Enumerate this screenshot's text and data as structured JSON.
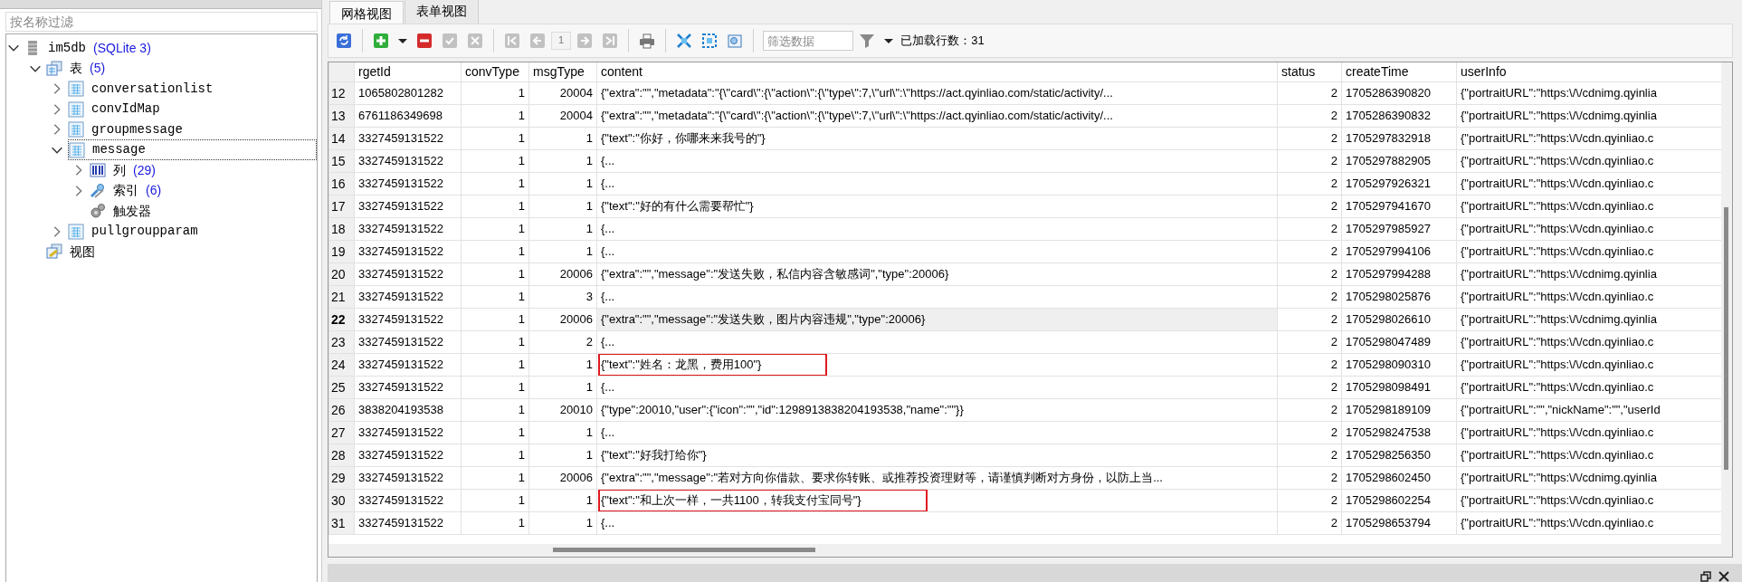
{
  "object_panel": {
    "filter": {
      "placeholder": "按名称过滤"
    },
    "tree": [
      {
        "label": "im5db",
        "count": "(SQLite 3)",
        "kind": "database",
        "expanded": true,
        "selected": false,
        "children": [
          {
            "label": "表",
            "count": "(5)",
            "kind": "tables",
            "expanded": true,
            "selected": false,
            "children": [
              {
                "label": "conversationlist",
                "kind": "table",
                "expanded": false,
                "selected": false
              },
              {
                "label": "convIdMap",
                "kind": "table",
                "expanded": false,
                "selected": false
              },
              {
                "label": "groupmessage",
                "kind": "table",
                "expanded": false,
                "selected": false
              },
              {
                "label": "message",
                "kind": "table",
                "expanded": true,
                "selected": true,
                "children": [
                  {
                    "label": "列",
                    "count": "(29)",
                    "kind": "columns",
                    "expanded": false,
                    "selected": false
                  },
                  {
                    "label": "索引",
                    "count": "(6)",
                    "kind": "indexes",
                    "expanded": false,
                    "selected": false
                  },
                  {
                    "label": "触发器",
                    "kind": "triggers",
                    "selected": false
                  }
                ]
              },
              {
                "label": "pullgroupparam",
                "kind": "table",
                "expanded": false,
                "selected": false
              }
            ]
          },
          {
            "label": "视图",
            "kind": "views",
            "selected": false
          }
        ]
      }
    ]
  },
  "tabs": [
    {
      "label": "网格视图",
      "selected": true
    },
    {
      "label": "表单视图",
      "selected": false
    }
  ],
  "toolbar": [
    {
      "kind": "refresh",
      "disabled": false
    },
    {
      "kind": "separator"
    },
    {
      "kind": "add",
      "disabled": false
    },
    {
      "kind": "caret",
      "disabled": false
    },
    {
      "kind": "delete",
      "disabled": false
    },
    {
      "kind": "confirm",
      "disabled": true
    },
    {
      "kind": "cancel",
      "disabled": true
    },
    {
      "kind": "separator"
    },
    {
      "kind": "first",
      "disabled": true
    },
    {
      "kind": "previous",
      "disabled": true
    },
    {
      "kind": "page",
      "value": "1"
    },
    {
      "kind": "next",
      "disabled": true
    },
    {
      "kind": "last",
      "disabled": true
    },
    {
      "kind": "separator"
    },
    {
      "kind": "print",
      "disabled": false
    },
    {
      "kind": "separator"
    },
    {
      "kind": "expand",
      "disabled": false
    },
    {
      "kind": "fit",
      "disabled": false
    },
    {
      "kind": "image",
      "disabled": false
    },
    {
      "kind": "separator"
    },
    {
      "kind": "filter",
      "placeholder": "筛选数据"
    },
    {
      "kind": "funnel",
      "disabled": false
    },
    {
      "kind": "caret",
      "disabled": false
    },
    {
      "kind": "label",
      "text": "已加载行数：31"
    }
  ],
  "table": {
    "columns": [
      "rgetId",
      "convType",
      "msgType",
      "content",
      "status",
      "createTime",
      "userInfo"
    ],
    "rows": [
      {
        "number": "12",
        "cells": [
          "1065802801282",
          "1",
          "20004",
          "{\"extra\":\"\",\"metadata\":\"{\\\"card\\\":{\\\"action\\\":{\\\"type\\\":7,\\\"url\\\":\\\"https://act.qyinliao.com/static/activity/...",
          "2",
          "1705286390820",
          "{\"portraitURL\":\"https:\\/\\/cdnimg.qyinlia"
        ],
        "selected": false,
        "highlighted": false
      },
      {
        "number": "13",
        "cells": [
          "6761186349698",
          "1",
          "20004",
          "{\"extra\":\"\",\"metadata\":\"{\\\"card\\\":{\\\"action\\\":{\\\"type\\\":7,\\\"url\\\":\\\"https://act.qyinliao.com/static/activity/...",
          "2",
          "1705286390832",
          "{\"portraitURL\":\"https:\\/\\/cdnimg.qyinlia"
        ],
        "selected": false,
        "highlighted": false
      },
      {
        "number": "14",
        "cells": [
          "3327459131522",
          "1",
          "1",
          "{\"text\":\"你好，你哪来来我号的\"}",
          "2",
          "1705297832918",
          "{\"portraitURL\":\"https:\\/\\/cdn.qyinliao.c"
        ],
        "selected": false,
        "highlighted": false
      },
      {
        "number": "15",
        "cells": [
          "3327459131522",
          "1",
          "1",
          "{...",
          "2",
          "1705297882905",
          "{\"portraitURL\":\"https:\\/\\/cdn.qyinliao.c"
        ],
        "selected": false,
        "highlighted": false
      },
      {
        "number": "16",
        "cells": [
          "3327459131522",
          "1",
          "1",
          "{...",
          "2",
          "1705297926321",
          "{\"portraitURL\":\"https:\\/\\/cdn.qyinliao.c"
        ],
        "selected": false,
        "highlighted": false
      },
      {
        "number": "17",
        "cells": [
          "3327459131522",
          "1",
          "1",
          "{\"text\":\"好的有什么需要帮忙\"}",
          "2",
          "1705297941670",
          "{\"portraitURL\":\"https:\\/\\/cdn.qyinliao.c"
        ],
        "selected": false,
        "highlighted": false
      },
      {
        "number": "18",
        "cells": [
          "3327459131522",
          "1",
          "1",
          "{...",
          "2",
          "1705297985927",
          "{\"portraitURL\":\"https:\\/\\/cdn.qyinliao.c"
        ],
        "selected": false,
        "highlighted": false
      },
      {
        "number": "19",
        "cells": [
          "3327459131522",
          "1",
          "1",
          "{...",
          "2",
          "1705297994106",
          "{\"portraitURL\":\"https:\\/\\/cdn.qyinliao.c"
        ],
        "selected": false,
        "highlighted": false
      },
      {
        "number": "20",
        "cells": [
          "3327459131522",
          "1",
          "20006",
          "{\"extra\":\"\",\"message\":\"发送失败，私信内容含敏感词\",\"type\":20006}",
          "2",
          "1705297994288",
          "{\"portraitURL\":\"https:\\/\\/cdnimg.qyinlia"
        ],
        "selected": false,
        "highlighted": false
      },
      {
        "number": "21",
        "cells": [
          "3327459131522",
          "1",
          "3",
          "{...",
          "2",
          "1705298025876",
          "{\"portraitURL\":\"https:\\/\\/cdn.qyinliao.c"
        ],
        "selected": false,
        "highlighted": false
      },
      {
        "number": "22",
        "cells": [
          "3327459131522",
          "1",
          "20006",
          "{\"extra\":\"\",\"message\":\"发送失败，图片内容违规\",\"type\":20006}",
          "2",
          "1705298026610",
          "{\"portraitURL\":\"https:\\/\\/cdnimg.qyinlia"
        ],
        "selected": true,
        "highlighted": false
      },
      {
        "number": "23",
        "cells": [
          "3327459131522",
          "1",
          "2",
          "{...",
          "2",
          "1705298047489",
          "{\"portraitURL\":\"https:\\/\\/cdn.qyinliao.c"
        ],
        "selected": false,
        "highlighted": false
      },
      {
        "number": "24",
        "cells": [
          "3327459131522",
          "1",
          "1",
          "{\"text\":\"姓名：龙黑，费用100\"}",
          "2",
          "1705298090310",
          "{\"portraitURL\":\"https:\\/\\/cdn.qyinliao.c"
        ],
        "selected": false,
        "highlighted": true
      },
      {
        "number": "25",
        "cells": [
          "3327459131522",
          "1",
          "1",
          "{...",
          "2",
          "1705298098491",
          "{\"portraitURL\":\"https:\\/\\/cdn.qyinliao.c"
        ],
        "selected": false,
        "highlighted": false
      },
      {
        "number": "26",
        "cells": [
          "3838204193538",
          "1",
          "20010",
          "{\"type\":20010,\"user\":{\"icon\":\"\",\"id\":1298913838204193538,\"name\":\"\"}}",
          "2",
          "1705298189109",
          "{\"portraitURL\":\"\",\"nickName\":\"\",\"userId"
        ],
        "selected": false,
        "highlighted": false
      },
      {
        "number": "27",
        "cells": [
          "3327459131522",
          "1",
          "1",
          "{...",
          "2",
          "1705298247538",
          "{\"portraitURL\":\"https:\\/\\/cdn.qyinliao.c"
        ],
        "selected": false,
        "highlighted": false
      },
      {
        "number": "28",
        "cells": [
          "3327459131522",
          "1",
          "1",
          "{\"text\":\"好我打给你\"}",
          "2",
          "1705298256350",
          "{\"portraitURL\":\"https:\\/\\/cdn.qyinliao.c"
        ],
        "selected": false,
        "highlighted": false
      },
      {
        "number": "29",
        "cells": [
          "3327459131522",
          "1",
          "20006",
          "{\"extra\":\"\",\"message\":\"若对方向你借款、要求你转账、或推荐投资理财等，请谨慎判断对方身份，以防上当...",
          "2",
          "1705298602450",
          "{\"portraitURL\":\"https:\\/\\/cdnimg.qyinlia"
        ],
        "selected": false,
        "highlighted": false
      },
      {
        "number": "30",
        "cells": [
          "3327459131522",
          "1",
          "1",
          "{\"text\":\"和上次一样，一共1100，转我支付宝同号\"}",
          "2",
          "1705298602254",
          "{\"portraitURL\":\"https:\\/\\/cdn.qyinliao.c"
        ],
        "selected": false,
        "highlighted": true
      },
      {
        "number": "31",
        "cells": [
          "3327459131522",
          "1",
          "1",
          "{...",
          "2",
          "1705298653794",
          "{\"portraitURL\":\"https:\\/\\/cdn.qyinliao.c"
        ],
        "selected": false,
        "highlighted": false
      }
    ]
  }
}
